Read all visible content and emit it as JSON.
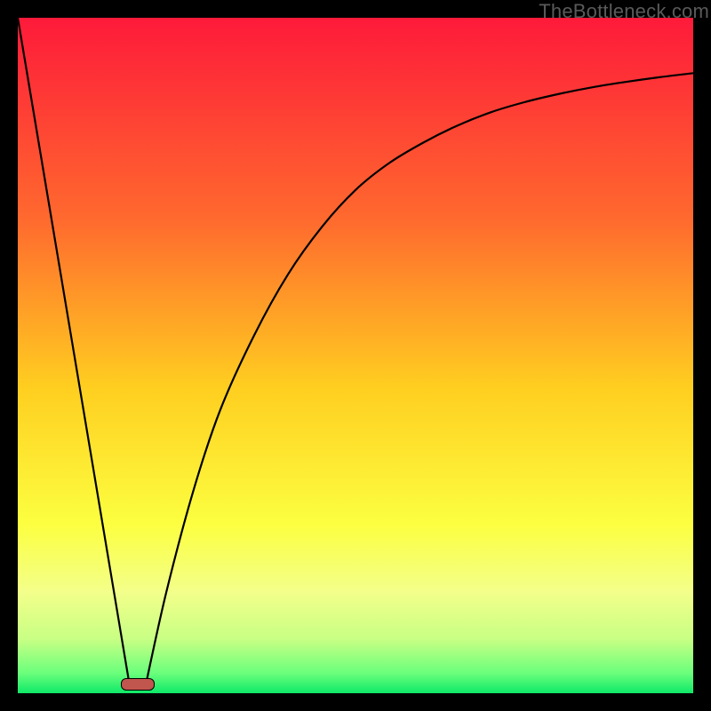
{
  "attribution": "TheBottleneck.com",
  "colors": {
    "bg_black": "#000000",
    "gradient_top": "#fe1a3a",
    "gradient_mid1": "#ff8a2c",
    "gradient_mid2": "#ffe524",
    "gradient_mid3": "#fbff67",
    "gradient_mid4": "#e0ff7a",
    "gradient_bottom": "#1aee73",
    "curve": "#000000",
    "marker_fill": "#c1564e"
  },
  "chart_data": {
    "type": "line",
    "title": "",
    "xlabel": "",
    "ylabel": "",
    "xlim": [
      0,
      100
    ],
    "ylim": [
      0,
      100
    ],
    "grid": false,
    "notes": "Bottleneck chart: vertical gradient background red→green. Two black curves meeting near bottom. Small rounded marker at minimum.",
    "series": [
      {
        "name": "left-line",
        "x": [
          0,
          16.5
        ],
        "values": [
          100,
          1.5
        ]
      },
      {
        "name": "right-curve",
        "x": [
          19,
          22,
          26,
          30,
          35,
          40,
          45,
          50,
          55,
          60,
          65,
          70,
          75,
          80,
          85,
          90,
          95,
          100
        ],
        "values": [
          1.5,
          15,
          30,
          42,
          53,
          62,
          69,
          74.5,
          78.5,
          81.5,
          84,
          86,
          87.5,
          88.7,
          89.7,
          90.5,
          91.2,
          91.8
        ]
      }
    ],
    "marker": {
      "x": 17.8,
      "y": 1.3
    },
    "gradient_stops": [
      {
        "pct": 0,
        "color": "#fe1a3a"
      },
      {
        "pct": 30,
        "color": "#ff6a2e"
      },
      {
        "pct": 55,
        "color": "#ffcf20"
      },
      {
        "pct": 75,
        "color": "#fcff40"
      },
      {
        "pct": 85,
        "color": "#f3ff8a"
      },
      {
        "pct": 92,
        "color": "#c8ff84"
      },
      {
        "pct": 97,
        "color": "#6bff7c"
      },
      {
        "pct": 100,
        "color": "#0fe968"
      }
    ]
  }
}
